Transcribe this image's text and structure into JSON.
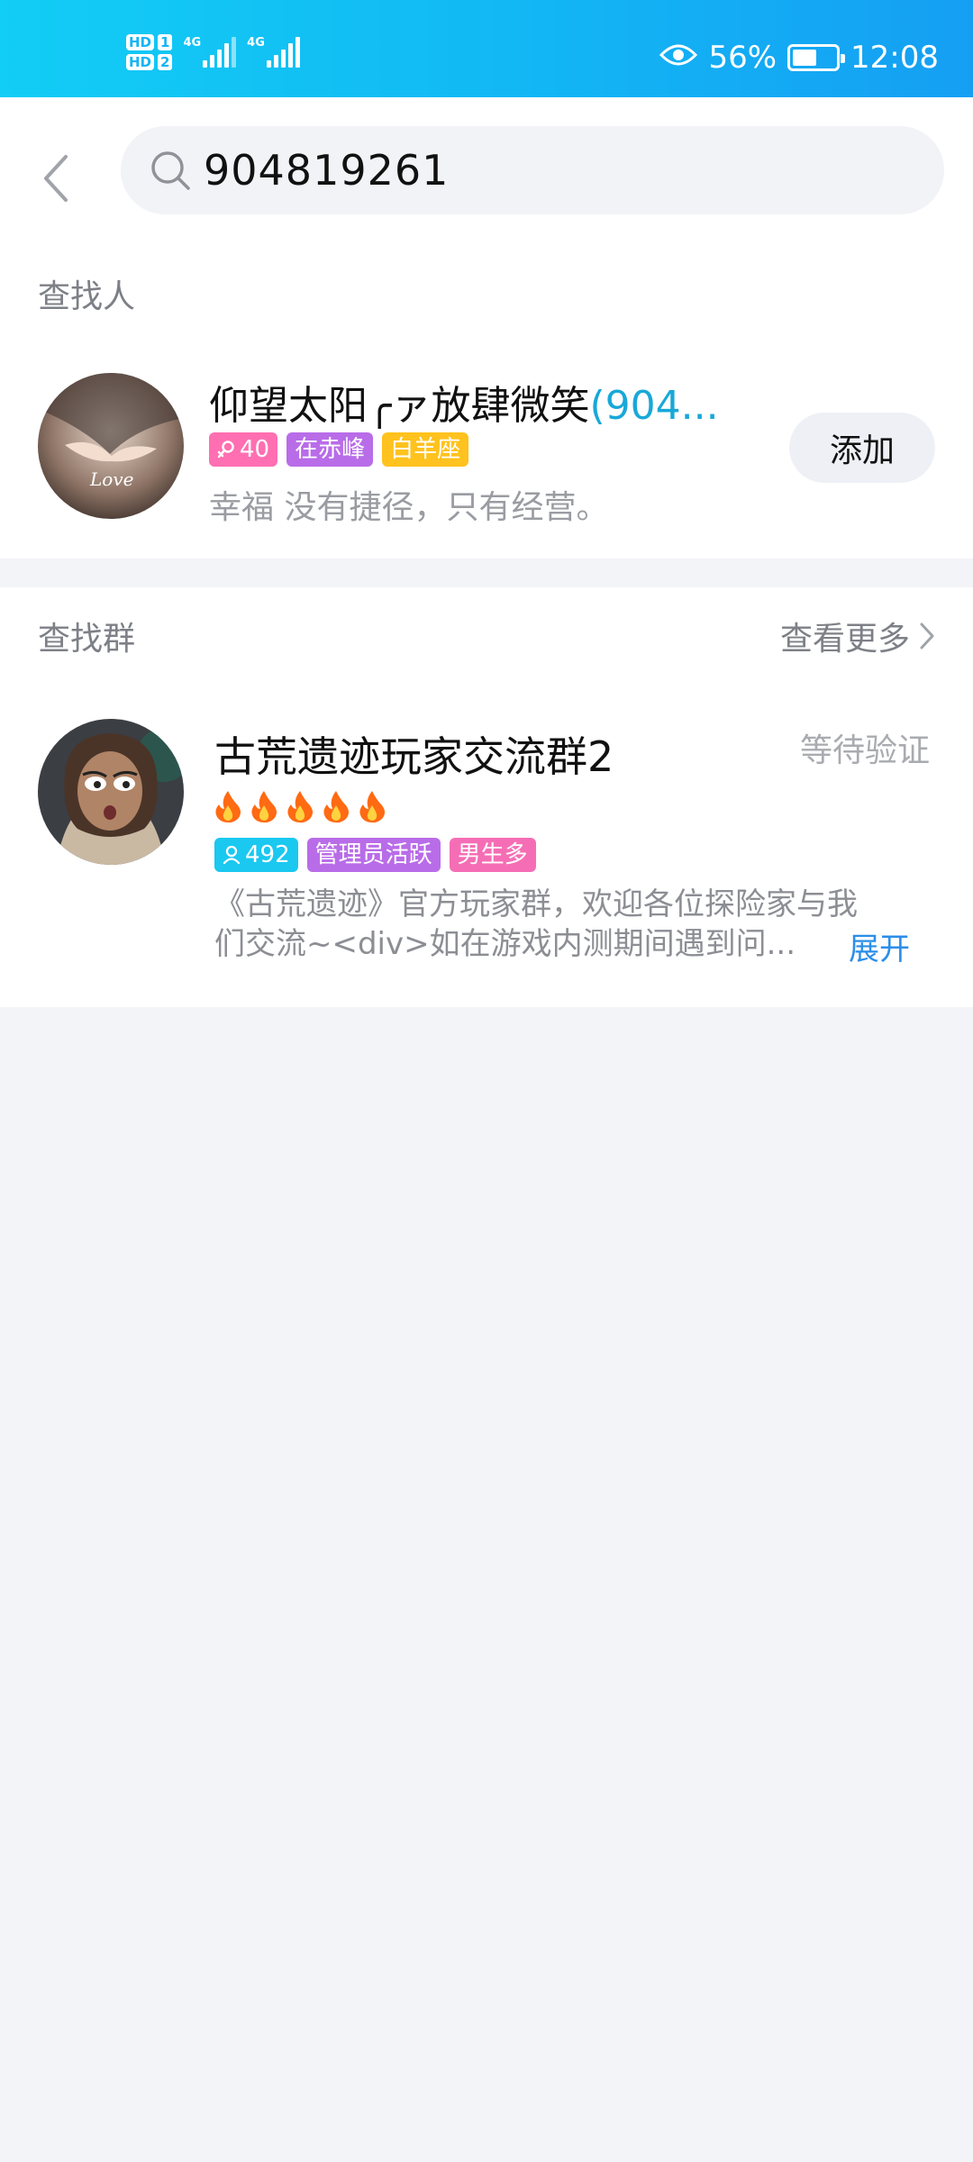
{
  "status_bar": {
    "hd_labels": [
      "HD",
      "HD"
    ],
    "sim_numbers": [
      "1",
      "2"
    ],
    "network_types": [
      "4G",
      "4G"
    ],
    "battery_percent": "56%",
    "time": "12:08",
    "battery_level": 0.56
  },
  "search": {
    "query": "904819261"
  },
  "people_section": {
    "title": "查找人",
    "result": {
      "name": "仰望太阳╭ァ放肆微笑",
      "id_suffix": "(904...",
      "tags": [
        {
          "text": "40",
          "icon": "female-icon",
          "color": "#ff6fb1"
        },
        {
          "text": "在赤峰",
          "color": "#b96ce8"
        },
        {
          "text": "白羊座",
          "color": "#ffc21e"
        }
      ],
      "signature": "幸福 没有捷径，只有经营。",
      "add_label": "添加"
    }
  },
  "groups_section": {
    "title": "查找群",
    "see_more": "查看更多",
    "result": {
      "name": "古荒遗迹玩家交流群2",
      "status": "等待验证",
      "flame_count": 5,
      "tags": [
        {
          "text": "492",
          "icon": "member-icon",
          "color": "#1ac8f0"
        },
        {
          "text": "管理员活跃",
          "color": "#b96ce8"
        },
        {
          "text": "男生多",
          "color": "#f56eb5"
        }
      ],
      "description_line1": "《古荒遗迹》官方玩家群，欢迎各位探险家与我",
      "description_line2": "们交流~<div>如在游戏内测期间遇到问...",
      "expand_label": "展开"
    }
  }
}
